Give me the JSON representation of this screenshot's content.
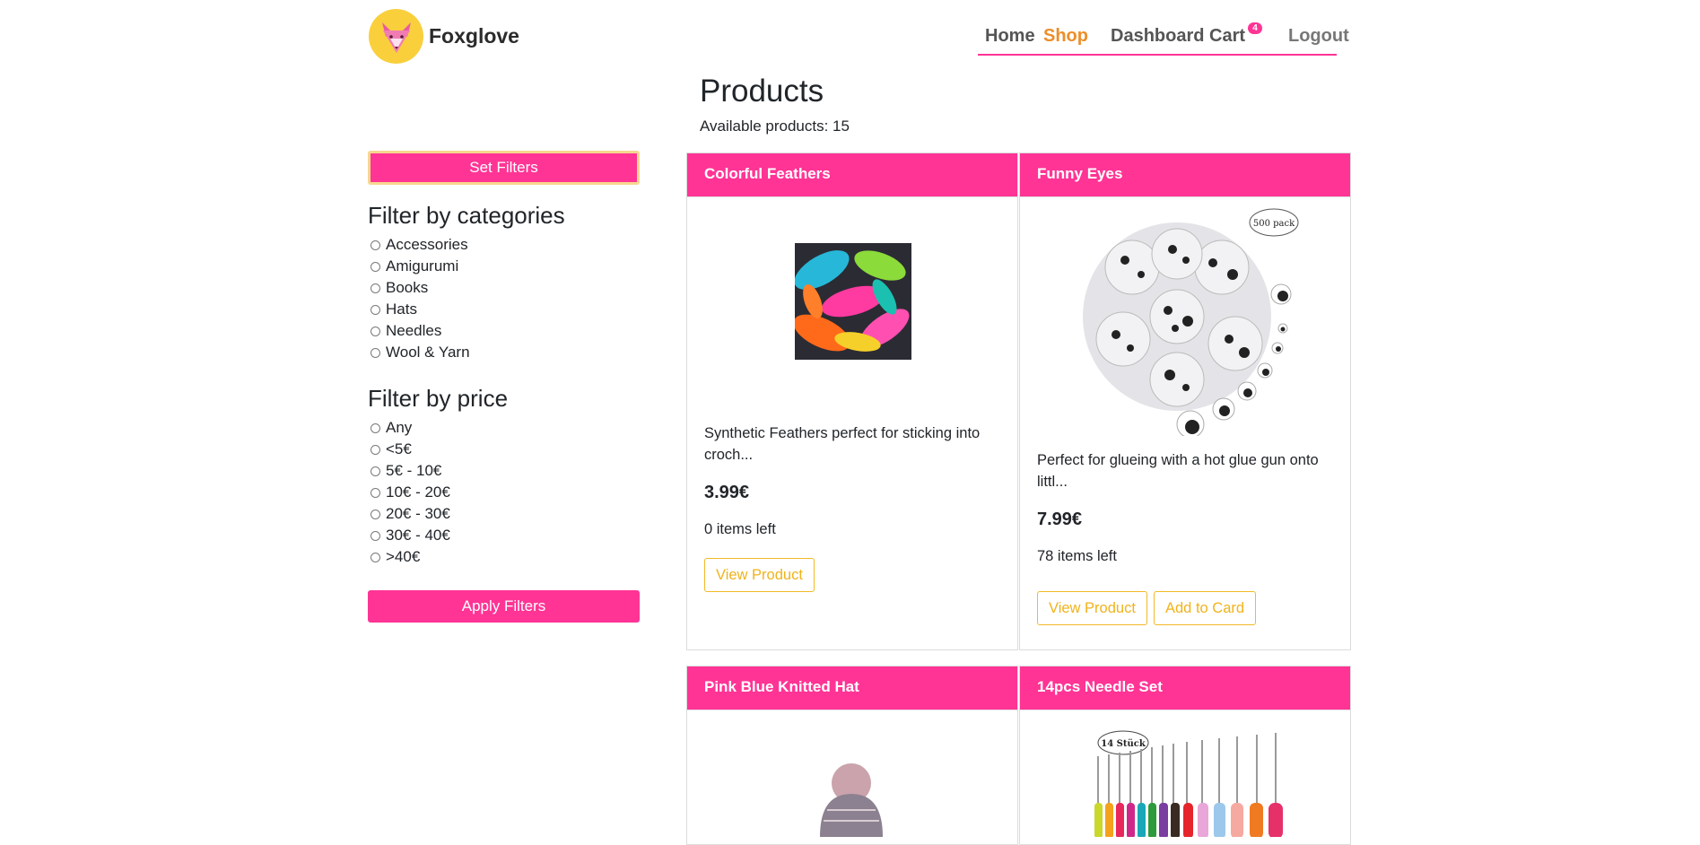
{
  "brand": {
    "name": "Foxglove"
  },
  "nav": {
    "home": "Home",
    "shop": "Shop",
    "dashboard": "Dashboard",
    "cart": "Cart",
    "cart_count": "4",
    "logout": "Logout"
  },
  "page": {
    "title": "Products",
    "available": "Available products: 15"
  },
  "sidebar": {
    "set_filters": "Set Filters",
    "categories_title": "Filter by categories",
    "categories": [
      "Accessories",
      "Amigurumi",
      "Books",
      "Hats",
      "Needles",
      "Wool & Yarn"
    ],
    "price_title": "Filter by price",
    "prices": [
      "Any",
      "<5€",
      "5€ - 10€",
      "10€ - 20€",
      "20€ - 30€",
      "30€ - 40€",
      ">40€"
    ],
    "apply": "Apply Filters"
  },
  "products": [
    {
      "title": "Colorful Feathers",
      "desc": "Synthetic Feathers perfect for sticking into croch...",
      "price": "3.99€",
      "stock": "0 items left",
      "view": "View Product"
    },
    {
      "title": "Funny Eyes",
      "badge": "500 pack",
      "desc": "Perfect for glueing with a hot glue gun onto littl...",
      "price": "7.99€",
      "stock": "78 items left",
      "view": "View Product",
      "add": "Add to Card"
    },
    {
      "title": "Pink Blue Knitted Hat"
    },
    {
      "title": "14pcs Needle Set",
      "badge": "14 Stück"
    }
  ],
  "colors": {
    "accent": "#ff3495",
    "active_nav": "#ec8e2a",
    "outline_button": "#f3b928",
    "logo_bg": "#f9cf3c"
  }
}
